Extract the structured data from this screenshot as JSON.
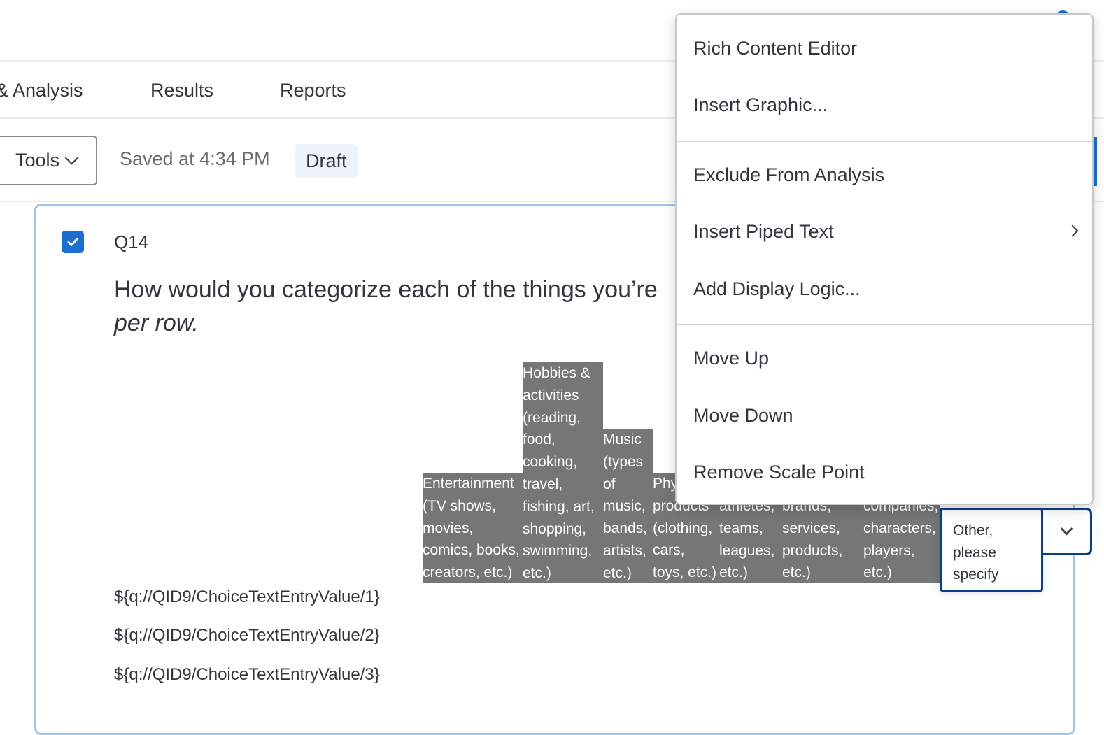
{
  "nav": {
    "tabs": [
      {
        "label": "& Analysis"
      },
      {
        "label": "Results"
      },
      {
        "label": "Reports"
      }
    ]
  },
  "toolbar": {
    "tools_label": "Tools",
    "saved_status": "Saved at 4:34 PM",
    "draft_badge": "Draft"
  },
  "question": {
    "id": "Q14",
    "checked": true,
    "text_main": "How would you categorize each of the things you’re",
    "text_italic": "per row.",
    "columns": [
      {
        "label": "Entertainment (TV shows, movies, comics, books, creators, etc.)",
        "display": "Entertainment\n(TV shows,\nmovies,\ncomics, books,\ncreators, etc.)"
      },
      {
        "label": "Hobbies & activities (reading, food, cooking, travel, fishing, art, shopping, swimming, etc.)",
        "display": "Hobbies &\nactivities\n(reading,\nfood,\ncooking,\ntravel,\nfishing, art,\nshopping,\nswimming,\netc.)"
      },
      {
        "label": "Music (types of music, bands, artists, etc.)",
        "display": "Music\n(types\nof\nmusic,\nbands,\nartists,\netc.)"
      },
      {
        "label": "Physical products (clothing, cars, toys, etc.)",
        "display": "Phy\nproducts\n(clothing,\ncars,\ntoys, etc.)"
      },
      {
        "label": "athletes, teams, leagues, etc.)",
        "display": "athletes,\nteams,\nleagues,\netc.)"
      },
      {
        "label": "brands, services, products, etc.)",
        "display": "brands,\nservices,\nproducts,\netc.)"
      },
      {
        "label": "companies, characters, players, etc.)",
        "display": "companies,\ncharacters,\nplayers,\netc.)"
      }
    ],
    "other_option": "Other,\nplease\nspecify",
    "rows": [
      "${q://QID9/ChoiceTextEntryValue/1}",
      "${q://QID9/ChoiceTextEntryValue/2}",
      "${q://QID9/ChoiceTextEntryValue/3}"
    ]
  },
  "context_menu": {
    "groups": [
      [
        "Rich Content Editor",
        "Insert Graphic..."
      ],
      [
        "Exclude From Analysis",
        "Insert Piped Text",
        "Add Display Logic..."
      ],
      [
        "Move Up",
        "Move Down",
        "Remove Scale Point"
      ]
    ],
    "submenu_item": "Insert Piped Text"
  },
  "colors": {
    "accent": "#1a6fd1",
    "card_border": "#9ec5ea",
    "focus_border": "#0b3d82",
    "header_bg": "#767676",
    "draft_bg": "#edf2fb"
  }
}
